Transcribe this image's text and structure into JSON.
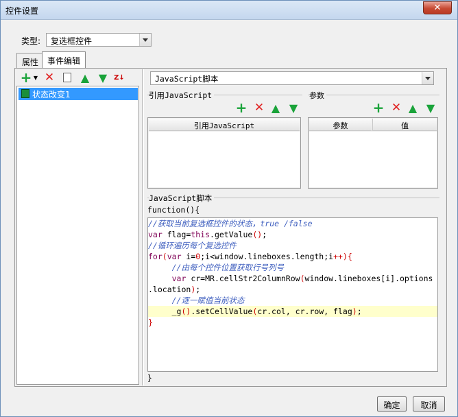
{
  "window": {
    "title": "控件设置",
    "close": "✕"
  },
  "type_row": {
    "label": "类型:",
    "value": "复选框控件"
  },
  "tabs": [
    "属性",
    "事件编辑"
  ],
  "left_toolbar": {
    "icons": [
      "add-icon",
      "delete-icon",
      "copy-icon",
      "move-up-icon",
      "move-down-icon",
      "sort-icon"
    ],
    "sort_text": "Z↓"
  },
  "events": [
    {
      "label": "状态改变1"
    }
  ],
  "script_type": {
    "value": "JavaScript脚本"
  },
  "ref_js": {
    "legend": "引用JavaScript",
    "col": "引用JavaScript"
  },
  "params": {
    "legend": "参数",
    "cols": [
      "参数",
      "值"
    ]
  },
  "script": {
    "legend": "JavaScript脚本",
    "header": "function(){",
    "footer": "}",
    "lines": [
      "//获取当前复选框控件的状态，true /false",
      "var flag=this.getValue();",
      "//循环遍历每个复选控件",
      "for(var i=0;i<window.lineboxes.length;i++){",
      "     //由每个控件位置获取行号列号",
      "     var cr=MR.cellStr2ColumnRow(window.lineboxes[i].options",
      ".location);",
      "     //逐一赋值当前状态",
      "     _g().setCellValue(cr.col, cr.row, flag);",
      "}"
    ]
  },
  "buttons": {
    "ok": "确定",
    "cancel": "取消"
  }
}
